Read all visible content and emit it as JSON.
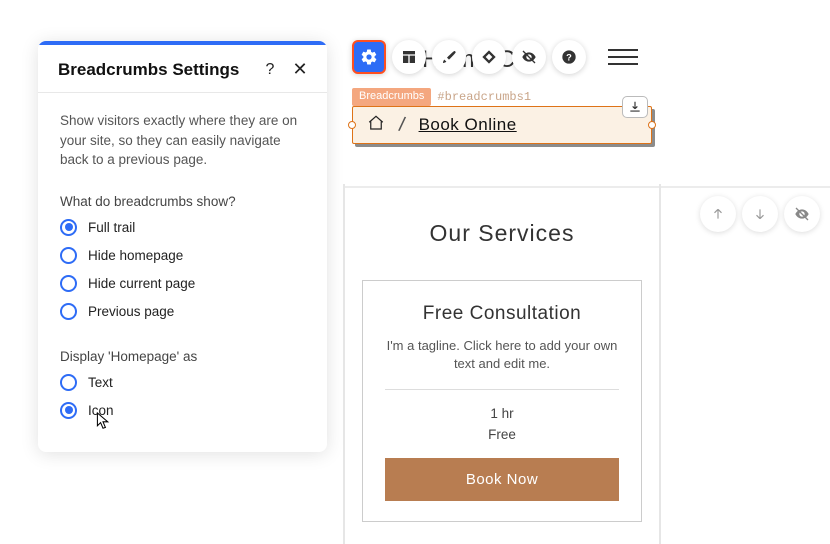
{
  "panel": {
    "title": "Breadcrumbs Settings",
    "description": "Show visitors exactly where they are on your site, so they can easily navigate back to a previous page.",
    "show_label": "What do breadcrumbs show?",
    "show_options": {
      "full_trail": "Full trail",
      "hide_homepage": "Hide homepage",
      "hide_current": "Hide current page",
      "previous_page": "Previous page"
    },
    "display_label": "Display 'Homepage' as",
    "display_options": {
      "text": "Text",
      "icon": "Icon"
    }
  },
  "editor": {
    "header_behind": "Home Cl",
    "element_tag": "Breadcrumbs",
    "element_id": "#breadcrumbs1",
    "breadcrumb_link": "Book Online",
    "section_heading": "Our Services",
    "service": {
      "title": "Free Consultation",
      "tagline": "I'm a tagline. Click here to add your own text and edit me.",
      "duration": "1 hr",
      "price": "Free",
      "cta": "Book Now"
    }
  }
}
